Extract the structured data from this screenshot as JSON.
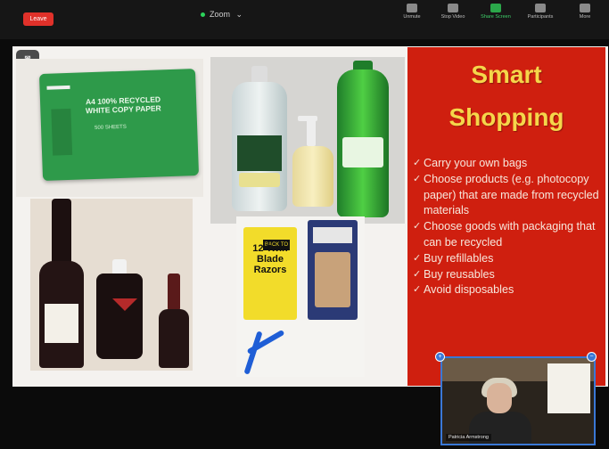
{
  "toolbar": {
    "leave_label": "Leave",
    "title": "Zoom",
    "title_chevron": "⌄",
    "items": [
      {
        "label": "Unmute",
        "icon": "microphone-icon"
      },
      {
        "label": "Stop Video",
        "icon": "video-camera-icon"
      },
      {
        "label": "Share Screen",
        "icon": "share-screen-icon"
      },
      {
        "label": "Participants",
        "icon": "participants-icon"
      },
      {
        "label": "More",
        "icon": "more-icon"
      }
    ]
  },
  "slide": {
    "title_line1": "Smart",
    "title_line2": "Shopping",
    "bullets": [
      "Carry your own bags",
      "Choose products (e.g. photocopy paper) that are made from recycled materials",
      "Choose goods with packaging that can be recycled",
      "Buy refillables",
      "Buy reusables",
      "Avoid disposables"
    ],
    "paper_pack_text": "A4 100% RECYCLED WHITE COPY PAPER",
    "paper_pack_sub": "500 SHEETS",
    "razor_text": "12 Twin Blade Razors",
    "razor_badge": "BACK TO BASICS",
    "colors": {
      "panel": "#cf1f0f",
      "title": "#f5d64a"
    }
  },
  "self_video": {
    "name": "Patricia Armstrong"
  }
}
